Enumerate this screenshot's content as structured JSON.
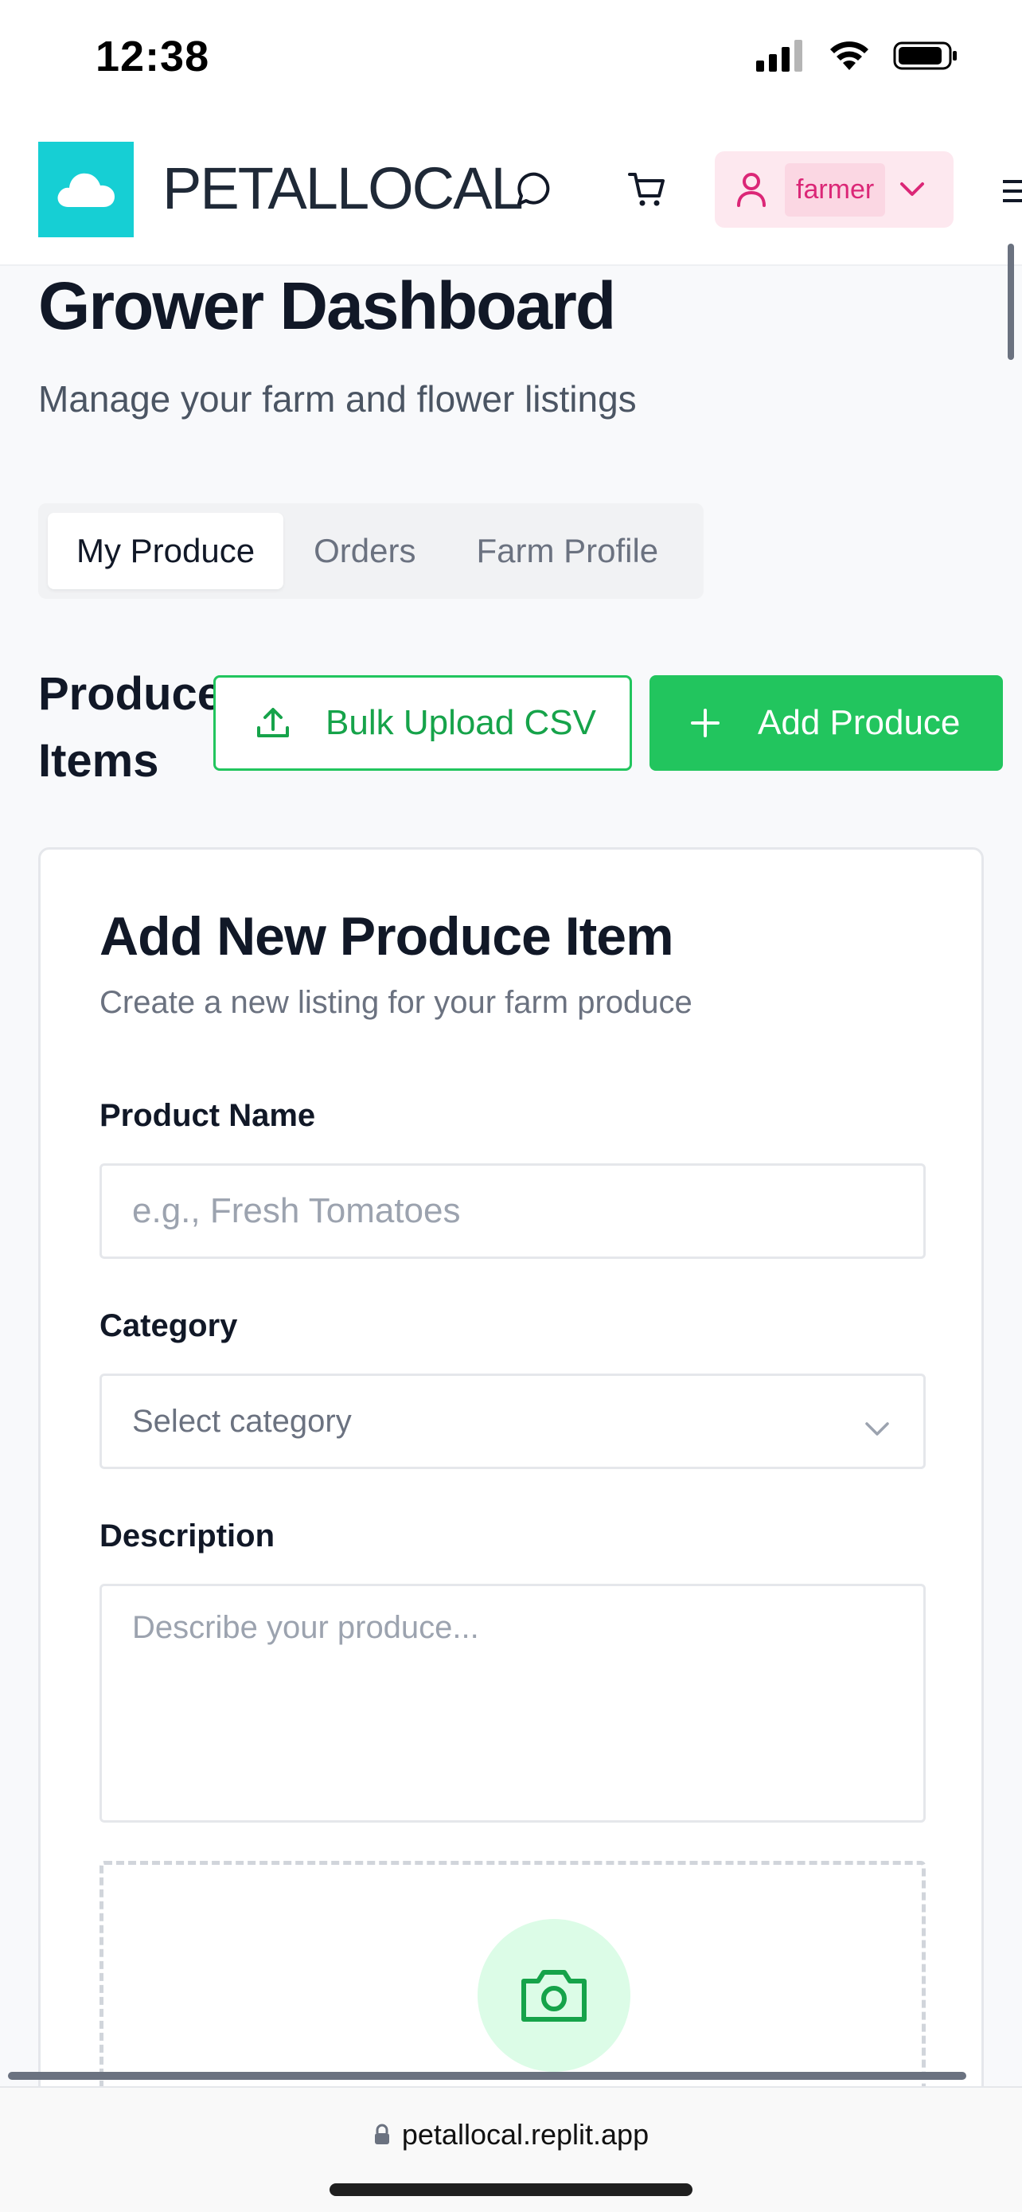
{
  "status_bar": {
    "time": "12:38"
  },
  "header": {
    "brand": "PETALLOCAL",
    "user_name": "farmer",
    "accent_color": "#16cfd4"
  },
  "page": {
    "title": "Grower Dashboard",
    "subtitle": "Manage your farm and flower listings"
  },
  "tabs": [
    {
      "label": "My Produce",
      "active": true
    },
    {
      "label": "Orders",
      "active": false
    },
    {
      "label": "Farm Profile",
      "active": false
    }
  ],
  "section": {
    "title": "Produce Items",
    "bulk_upload_label": "Bulk Upload CSV",
    "add_label": "Add Produce"
  },
  "form": {
    "title": "Add New Produce Item",
    "description": "Create a new listing for your farm produce",
    "product_name": {
      "label": "Product Name",
      "placeholder": "e.g., Fresh Tomatoes",
      "value": ""
    },
    "category": {
      "label": "Category",
      "placeholder": "Select category"
    },
    "description_field": {
      "label": "Description",
      "placeholder": "Describe your produce..."
    }
  },
  "browser": {
    "url": "petallocal.replit.app"
  },
  "colors": {
    "primary_green": "#22c55e",
    "user_pink": "#db2777"
  }
}
